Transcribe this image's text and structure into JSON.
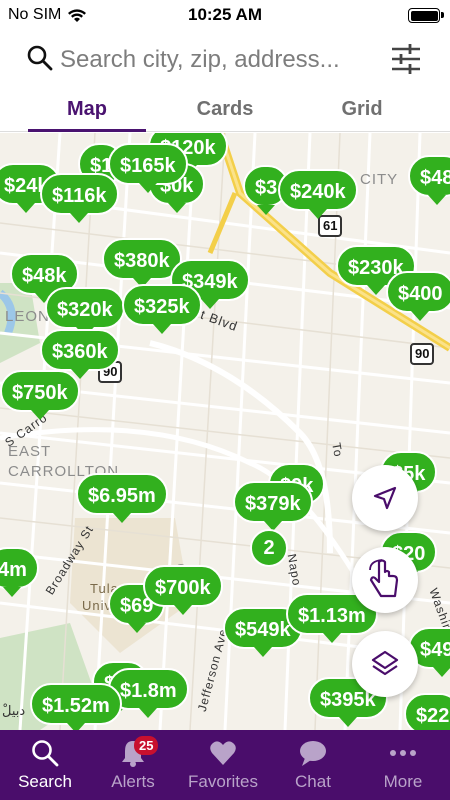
{
  "status": {
    "carrier": "No SIM",
    "time": "10:25 AM"
  },
  "search": {
    "placeholder": "Search city, zip, address..."
  },
  "tabs": [
    {
      "label": "Map",
      "active": true
    },
    {
      "label": "Cards",
      "active": false
    },
    {
      "label": "Grid",
      "active": false
    }
  ],
  "map": {
    "labels": [
      "CITY",
      "EAST",
      "CARROLLTON",
      "LEON",
      "t Blvd",
      "S Carro",
      "Broadway St",
      "Tulane",
      "Univers",
      "Jefferson Ave",
      "Napo",
      "Washin",
      "Ca",
      "To",
      "ْدبيل"
    ],
    "road_signs": [
      "61",
      "90",
      "90"
    ],
    "pins": [
      "$165k",
      "$120k",
      "$1",
      "$0k",
      "$24k",
      "$116k",
      "$3",
      "$240k",
      "$48",
      "$230k",
      "$400",
      "$48k",
      "$380k",
      "$349k",
      "$320k",
      "$325k",
      "$360k",
      "$750k",
      "$6.95m",
      "$379k",
      "$9k",
      "$5k",
      "$700k",
      "$69",
      "$549k",
      "$1.13m",
      "$1.8m",
      "$1.52m",
      "$0k",
      "$395k",
      "$49k",
      "$22",
      "$20",
      "4m"
    ],
    "clusters": [
      "2"
    ]
  },
  "fabs": [
    "locate-me-icon",
    "draw-search-icon",
    "map-layers-icon"
  ],
  "nav": {
    "items": [
      {
        "label": "Search",
        "icon": "search-icon",
        "active": true
      },
      {
        "label": "Alerts",
        "icon": "bell-icon",
        "badge": "25"
      },
      {
        "label": "Favorites",
        "icon": "heart-icon"
      },
      {
        "label": "Chat",
        "icon": "chat-icon"
      },
      {
        "label": "More",
        "icon": "more-icon"
      }
    ]
  },
  "colors": {
    "brand": "#4a0d6b",
    "pin": "#32b01e",
    "badge": "#c8102e"
  }
}
